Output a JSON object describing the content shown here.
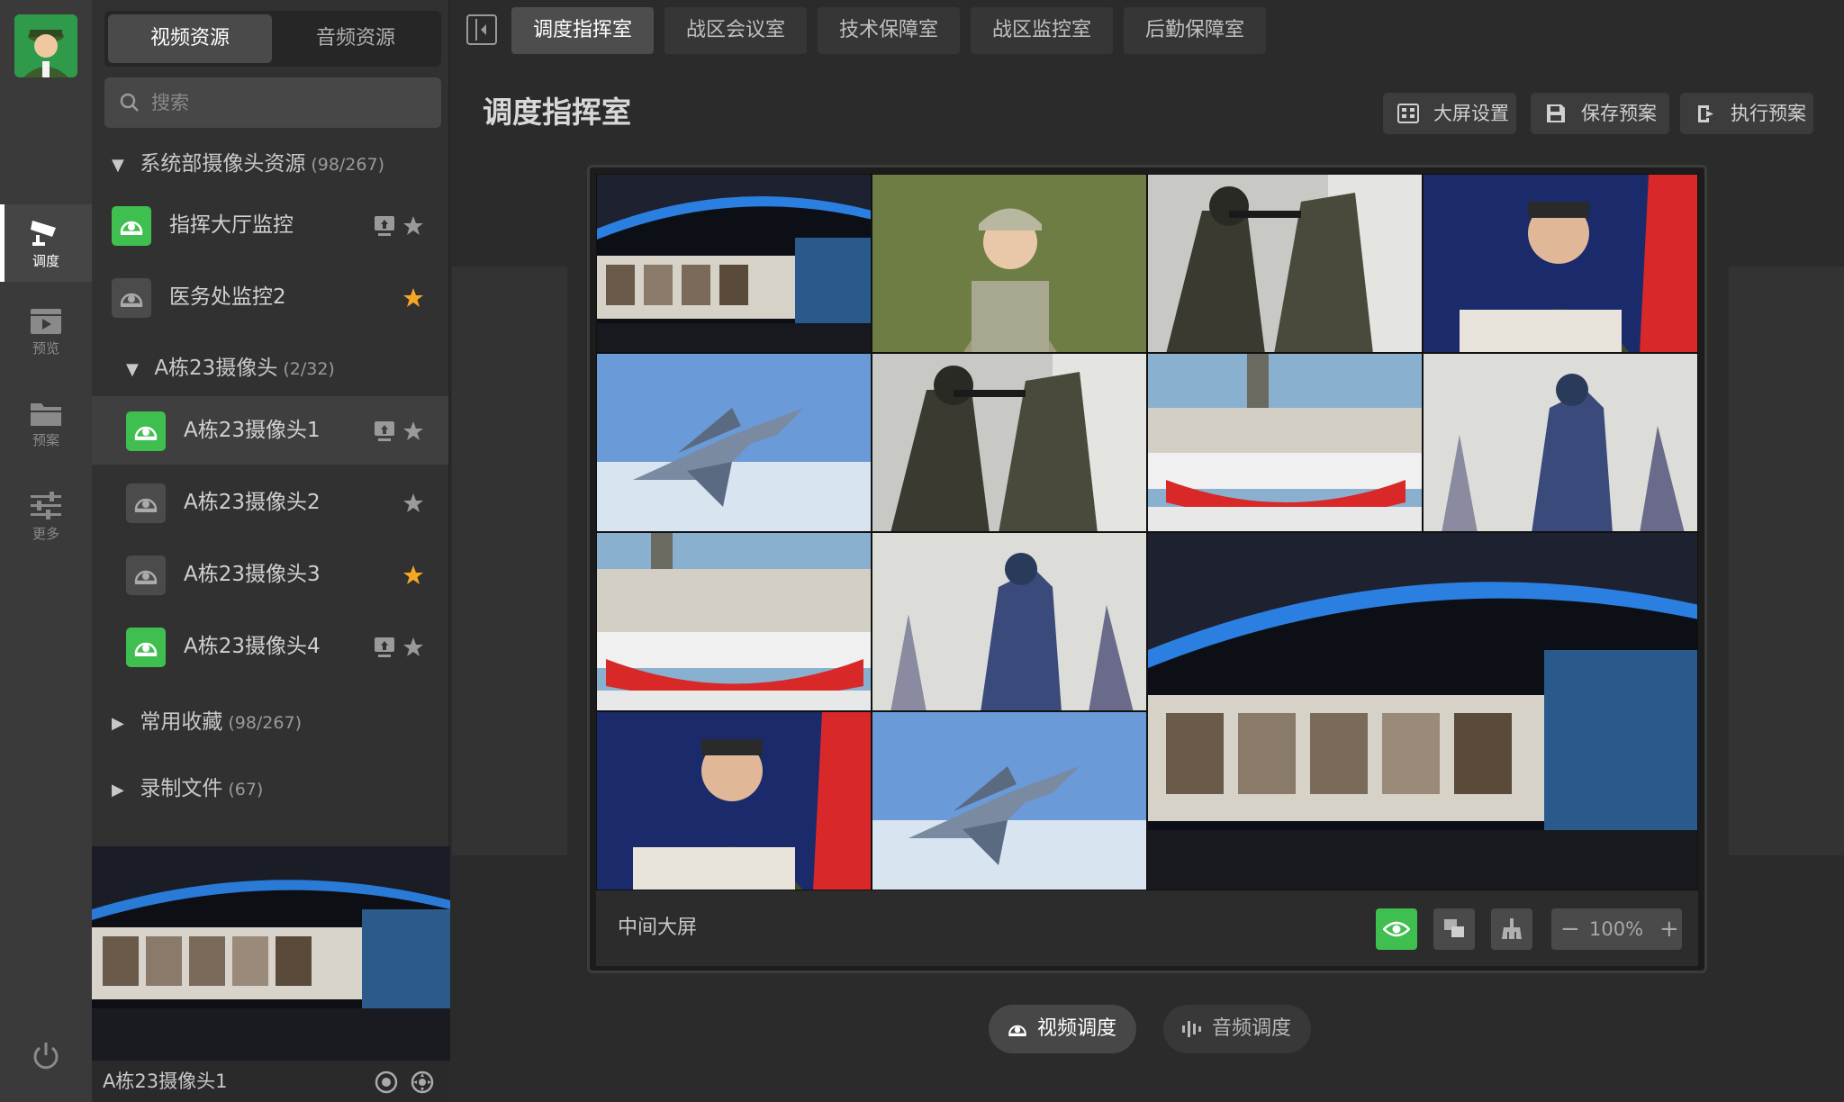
{
  "rail": {
    "items": [
      {
        "label": "调度",
        "icon": "camera-icon"
      },
      {
        "label": "预览",
        "icon": "video-icon"
      },
      {
        "label": "预案",
        "icon": "folder-icon"
      },
      {
        "label": "更多",
        "icon": "sliders-icon"
      }
    ]
  },
  "resources": {
    "tabs": [
      "视频资源",
      "音频资源"
    ],
    "search_placeholder": "搜索",
    "group1": {
      "label": "系统部摄像头资源",
      "count": "(98/267)"
    },
    "cameras_top": [
      {
        "label": "指挥大厅监控",
        "online": true,
        "starred": false
      },
      {
        "label": "医务处监控2",
        "online": false,
        "starred": true
      }
    ],
    "group2": {
      "label": "A栋23摄像头",
      "count": "(2/32)"
    },
    "cameras_sub": [
      {
        "label": "A栋23摄像头1",
        "online": true,
        "starred": false
      },
      {
        "label": "A栋23摄像头2",
        "online": false,
        "starred": false
      },
      {
        "label": "A栋23摄像头3",
        "online": false,
        "starred": true
      },
      {
        "label": "A栋23摄像头4",
        "online": true,
        "starred": false
      }
    ],
    "group3": {
      "label": "常用收藏",
      "count": "(98/267)"
    },
    "group4": {
      "label": "录制文件",
      "count": "(67)"
    },
    "preview_label": "A栋23摄像头1"
  },
  "rooms": [
    "调度指挥室",
    "战区会议室",
    "技术保障室",
    "战区监控室",
    "后勤保障室"
  ],
  "page": {
    "title": "调度指挥室",
    "tools": [
      "大屏设置",
      "保存预案",
      "执行预案"
    ]
  },
  "wall": {
    "name": "中间大屏",
    "zoom": "100%",
    "zoom_minus": "−",
    "zoom_plus": "+"
  },
  "dispatch": [
    "视频调度",
    "音频调度"
  ],
  "colors": {
    "accent_green": "#3fbf4f",
    "star_orange": "#f5a623"
  }
}
